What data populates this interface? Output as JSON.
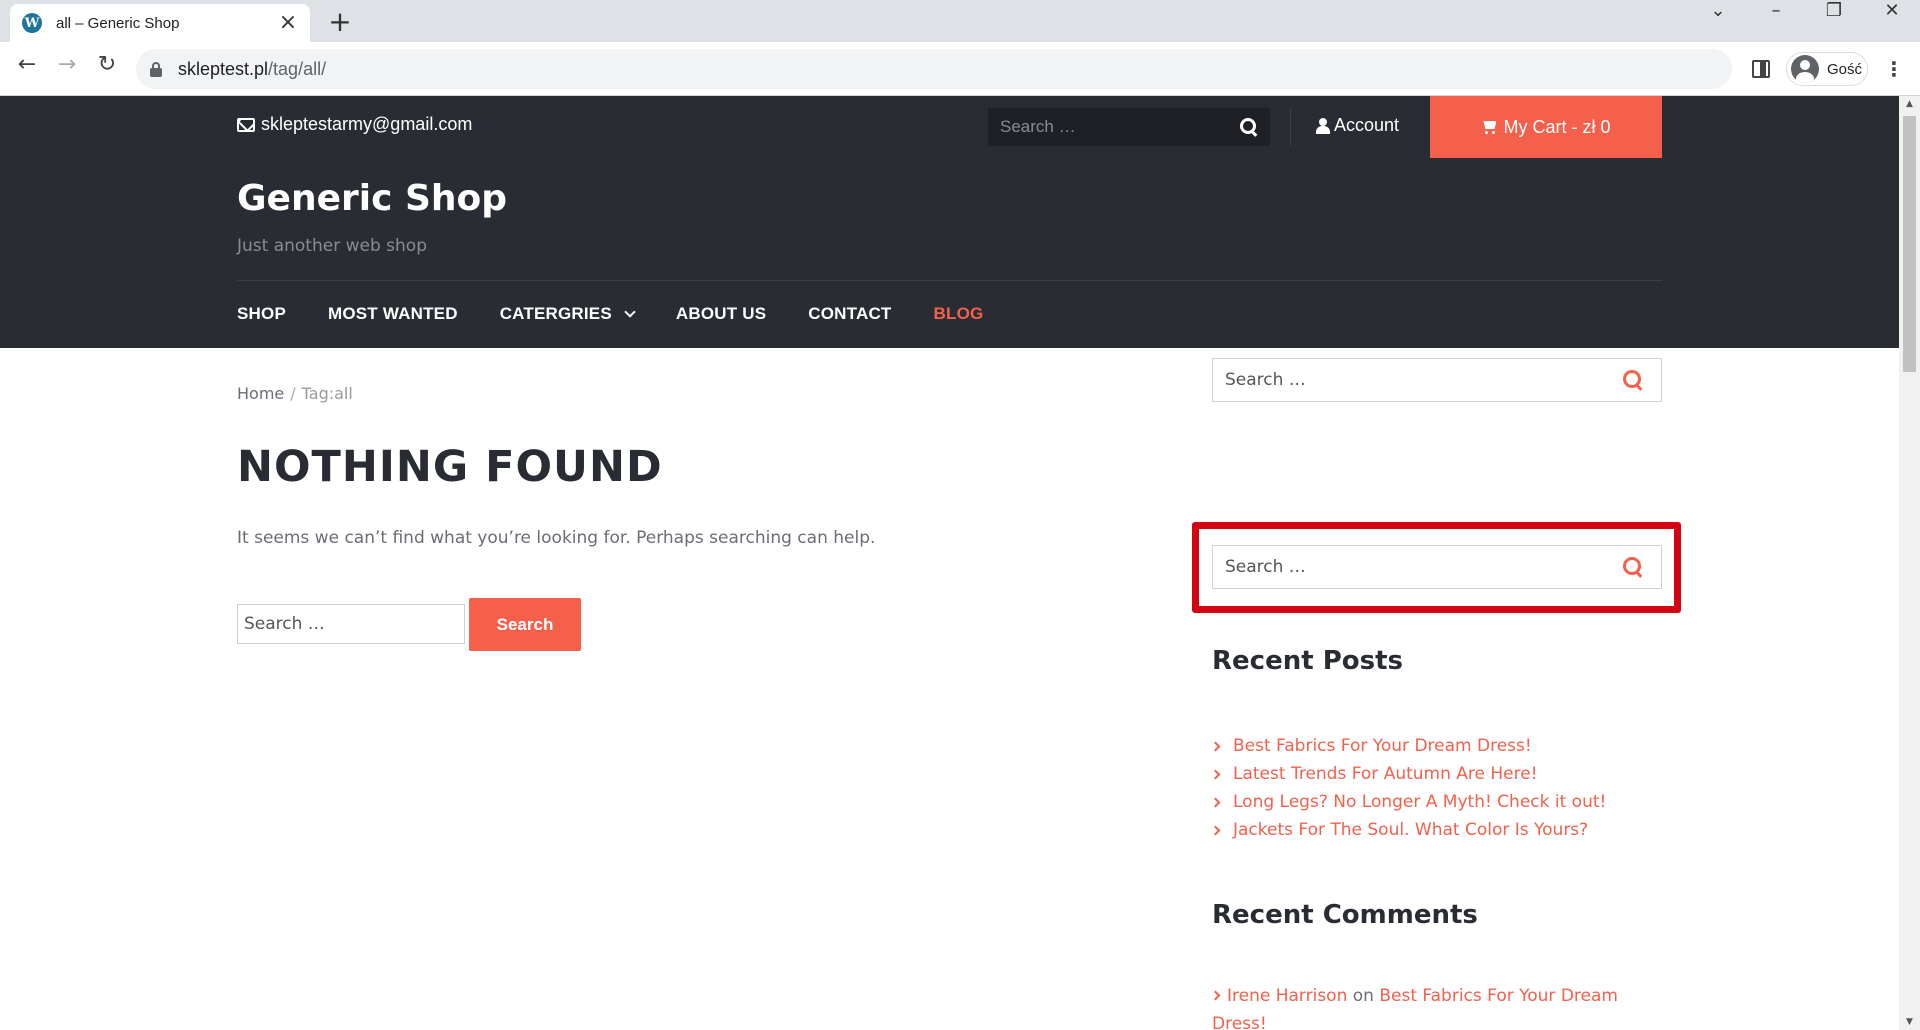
{
  "browser": {
    "tab_title": "all – Generic Shop",
    "url_host": "skleptest.pl",
    "url_path": "/tag/all/",
    "profile_name": "Gość"
  },
  "topbar": {
    "email": "skleptestarmy@gmail.com",
    "search_placeholder": "Search …",
    "account_label": "Account",
    "cart_label": "My Cart - zł 0"
  },
  "header": {
    "site_title": "Generic Shop",
    "tagline": "Just another web shop"
  },
  "nav": {
    "items": [
      "SHOP",
      "MOST WANTED",
      "CATERGRIES",
      "ABOUT US",
      "CONTACT",
      "BLOG"
    ]
  },
  "breadcrumb": {
    "home": "Home",
    "separator": "/",
    "current": "Tag:all"
  },
  "main": {
    "title": "NOTHING FOUND",
    "lead": "It seems we can’t find what you’re looking for. Perhaps searching can help.",
    "search_placeholder": "Search …",
    "search_button": "Search"
  },
  "sidebar": {
    "search_placeholder": "Search …",
    "recent_posts_title": "Recent Posts",
    "recent_posts": [
      "Best Fabrics For Your Dream Dress!",
      "Latest Trends For Autumn Are Here!",
      "Long Legs? No Longer A Myth! Check it out!",
      "Jackets For The Soul. What Color Is Yours?"
    ],
    "recent_comments_title": "Recent Comments",
    "comment": {
      "author": "Irene Harrison",
      "on": "on",
      "post": "Best Fabrics For Your Dream Dress!"
    }
  },
  "colors": {
    "accent": "#f4604b",
    "dark": "#2a2c33",
    "highlight": "#d30512"
  }
}
